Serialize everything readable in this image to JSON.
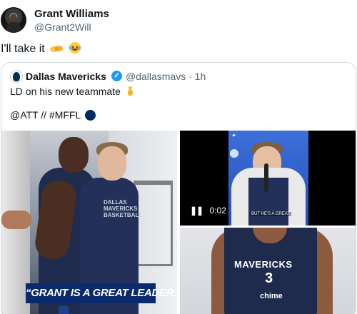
{
  "author": {
    "name": "Grant Williams",
    "handle": "@Grant2Will"
  },
  "tweet": {
    "text": "I'll take it",
    "emojis": [
      "handshake-icon",
      "laughing-crying-icon"
    ]
  },
  "quote": {
    "name": "Dallas Mavericks",
    "verified": true,
    "handle_time": "@dallasmavs · 1h",
    "line1": "LD on his new teammate",
    "line2": "@ATT // #MFFL",
    "media": {
      "photo_left_banner": "“GRANT IS A GREAT LEADER.”",
      "video_time": "0:02",
      "video_subtitle": "BUT HE'S A GREAT",
      "jersey_text": "MAVERICKS",
      "jersey_number": "3",
      "jersey_sponsor": "chime",
      "shirt_text": "DALLAS MAVERICKS BASKETBALL"
    }
  },
  "colors": {
    "accent": "#1d9bf0",
    "text": "#0f1419",
    "muted": "#536471",
    "border": "#cfd9de",
    "banner": "#0b2a6b"
  }
}
